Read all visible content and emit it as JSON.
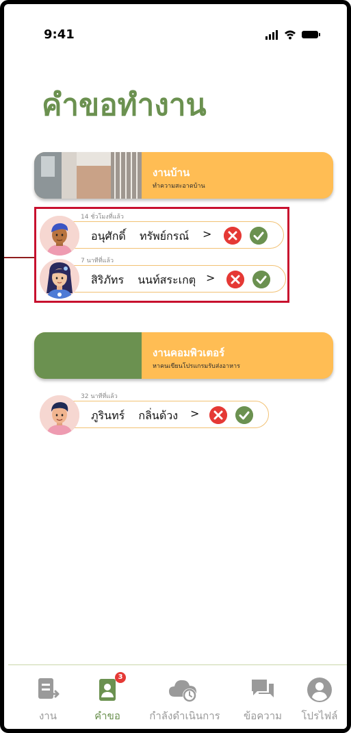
{
  "status_bar": {
    "time": "9:41"
  },
  "page_title": "คำขอทำงาน",
  "groups": [
    {
      "job": {
        "title": "งานบ้าน",
        "subtitle": "ทำความสะอาดบ้าน"
      },
      "requests": [
        {
          "time_ago": "14 ชั่วโมงที่แล้ว",
          "first_name": "อนุศักดิ์",
          "last_name": "ทรัพย์กรณ์"
        },
        {
          "time_ago": "7 นาทีที่แล้ว",
          "first_name": "สิริภัทร",
          "last_name": "นนท์สระเกตุ"
        }
      ]
    },
    {
      "job": {
        "title": "งานคอมพิวเตอร์",
        "subtitle": "หาคนเขียนโปรแกรมรับส่งอาหาร"
      },
      "requests": [
        {
          "time_ago": "32 นาทีที่แล้ว",
          "first_name": "ภูรินทร์",
          "last_name": "กลิ่นด้วง"
        }
      ]
    }
  ],
  "chevron": ">",
  "nav": {
    "items": [
      {
        "label": "งาน",
        "icon": "job-icon"
      },
      {
        "label": "คำขอ",
        "icon": "request-icon",
        "badge": "3",
        "active": true
      },
      {
        "label": "กำลังดำเนินการ",
        "icon": "in-progress-icon"
      },
      {
        "label": "ข้อความ",
        "icon": "message-icon"
      },
      {
        "label": "โปรไฟล์",
        "icon": "profile-icon"
      }
    ]
  },
  "colors": {
    "brand_green": "#6b9150",
    "card_orange": "#ffbd54",
    "reject_red": "#e53935"
  }
}
